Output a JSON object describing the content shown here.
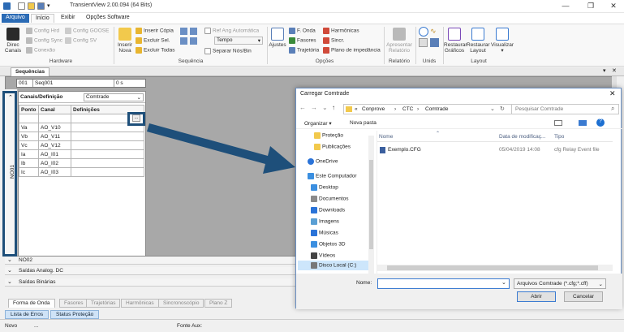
{
  "app": {
    "title": "TransientView 2.00.094 (64 Bits)"
  },
  "menu": {
    "arquivo": "Arquivo",
    "inicio": "Início",
    "exibir": "Exibir",
    "opcoes": "Opções Software"
  },
  "ribbon": {
    "hardware": {
      "label": "Hardware",
      "direc_canais": "Direc Canais",
      "config_hrd": "Config Hrd",
      "config_goose": "Config GOOSE",
      "config_sync": "Config Sync",
      "config_sv": "Config SV",
      "conexao": "Conexão"
    },
    "sequencia": {
      "label": "Sequência",
      "inserir_nova": "Inserir Nova",
      "inserir_copia": "Inserir Cópia",
      "excluir_sel": "Excluir Sel.",
      "excluir_todas": "Excluir Todas",
      "ref_ang": "Ref Ang Automática",
      "tempo": "Tempo",
      "separar": "Separar Nós/Bin"
    },
    "opcoes": {
      "label": "Opções",
      "ajustes": "Ajustes",
      "f_onda": "F. Onda",
      "harmonicas": "Harmônicas",
      "fasores": "Fasores",
      "sincr": "Sincr.",
      "trajetoria": "Trajetória",
      "plano": "Plano de impedância"
    },
    "relatorio": {
      "label": "Relatório",
      "apresentar": "Apresentar Relatório"
    },
    "unids": {
      "label": "Unids"
    },
    "layout": {
      "label": "Layout",
      "restaurar_graficos": "Restaurar Gráficos",
      "restaurar_layout": "Restaurar Layout",
      "visualizar": "Visualizar"
    }
  },
  "sequencias": {
    "tab": "Sequências",
    "row": {
      "num": "001",
      "name": "Seq001",
      "time": "0 s"
    }
  },
  "panel": {
    "header": "Canais/Definição",
    "select": "Comtrade",
    "columns": [
      "Ponto",
      "Canal",
      "Definições"
    ],
    "rows": [
      {
        "ponto": "Va",
        "canal": "AO_V10"
      },
      {
        "ponto": "Vb",
        "canal": "AO_V11"
      },
      {
        "ponto": "Vc",
        "canal": "AO_V12"
      },
      {
        "ponto": "Ia",
        "canal": "AO_I01"
      },
      {
        "ponto": "Ib",
        "canal": "AO_I02"
      },
      {
        "ponto": "Ic",
        "canal": "AO_I03"
      }
    ],
    "dots": "...",
    "side_label": "NO01"
  },
  "collapsed": {
    "no02": "NO02",
    "analog": "Saídas Analog. DC",
    "binarias": "Saídas Binárias"
  },
  "tabs": [
    "Forma de Onda",
    "Fasores",
    "Trajetórias",
    "Harmônicas",
    "Sincronoscópio",
    "Plano Z"
  ],
  "bottom_tabs": [
    "Lista de Erros",
    "Status Proteção"
  ],
  "status": {
    "left": "Novo",
    "mid": "...",
    "right": "Fonte Aux:"
  },
  "dialog": {
    "title": "Carregar Comtrade",
    "breadcrumb": [
      "«",
      "Conprove",
      "CTC",
      "Comtrade"
    ],
    "search_placeholder": "Pesquisar Comtrade",
    "organizar": "Organizar",
    "nova_pasta": "Nova pasta",
    "nav": [
      "Proteção",
      "Publicações",
      "OneDrive",
      "Este Computador",
      "Desktop",
      "Documentos",
      "Downloads",
      "Imagens",
      "Músicas",
      "Objetos 3D",
      "Vídeos",
      "Disco Local (C:)"
    ],
    "columns": {
      "nome": "Nome",
      "data": "Data de modificaç...",
      "tipo": "Tipo"
    },
    "files": [
      {
        "name": "Exemplo.CFG",
        "date": "05/04/2019 14:08",
        "type": "cfg Relay Event file"
      }
    ],
    "nome_label": "Nome:",
    "nome_value": "",
    "filetype": "Arquivos Comtrade (*.cfg;*.cff)",
    "abrir": "Abrir",
    "cancelar": "Cancelar"
  },
  "colors": {
    "accent": "#2b6bb5",
    "highlight_box": "#1e4f7a",
    "arrow": "#1e4f7a"
  }
}
